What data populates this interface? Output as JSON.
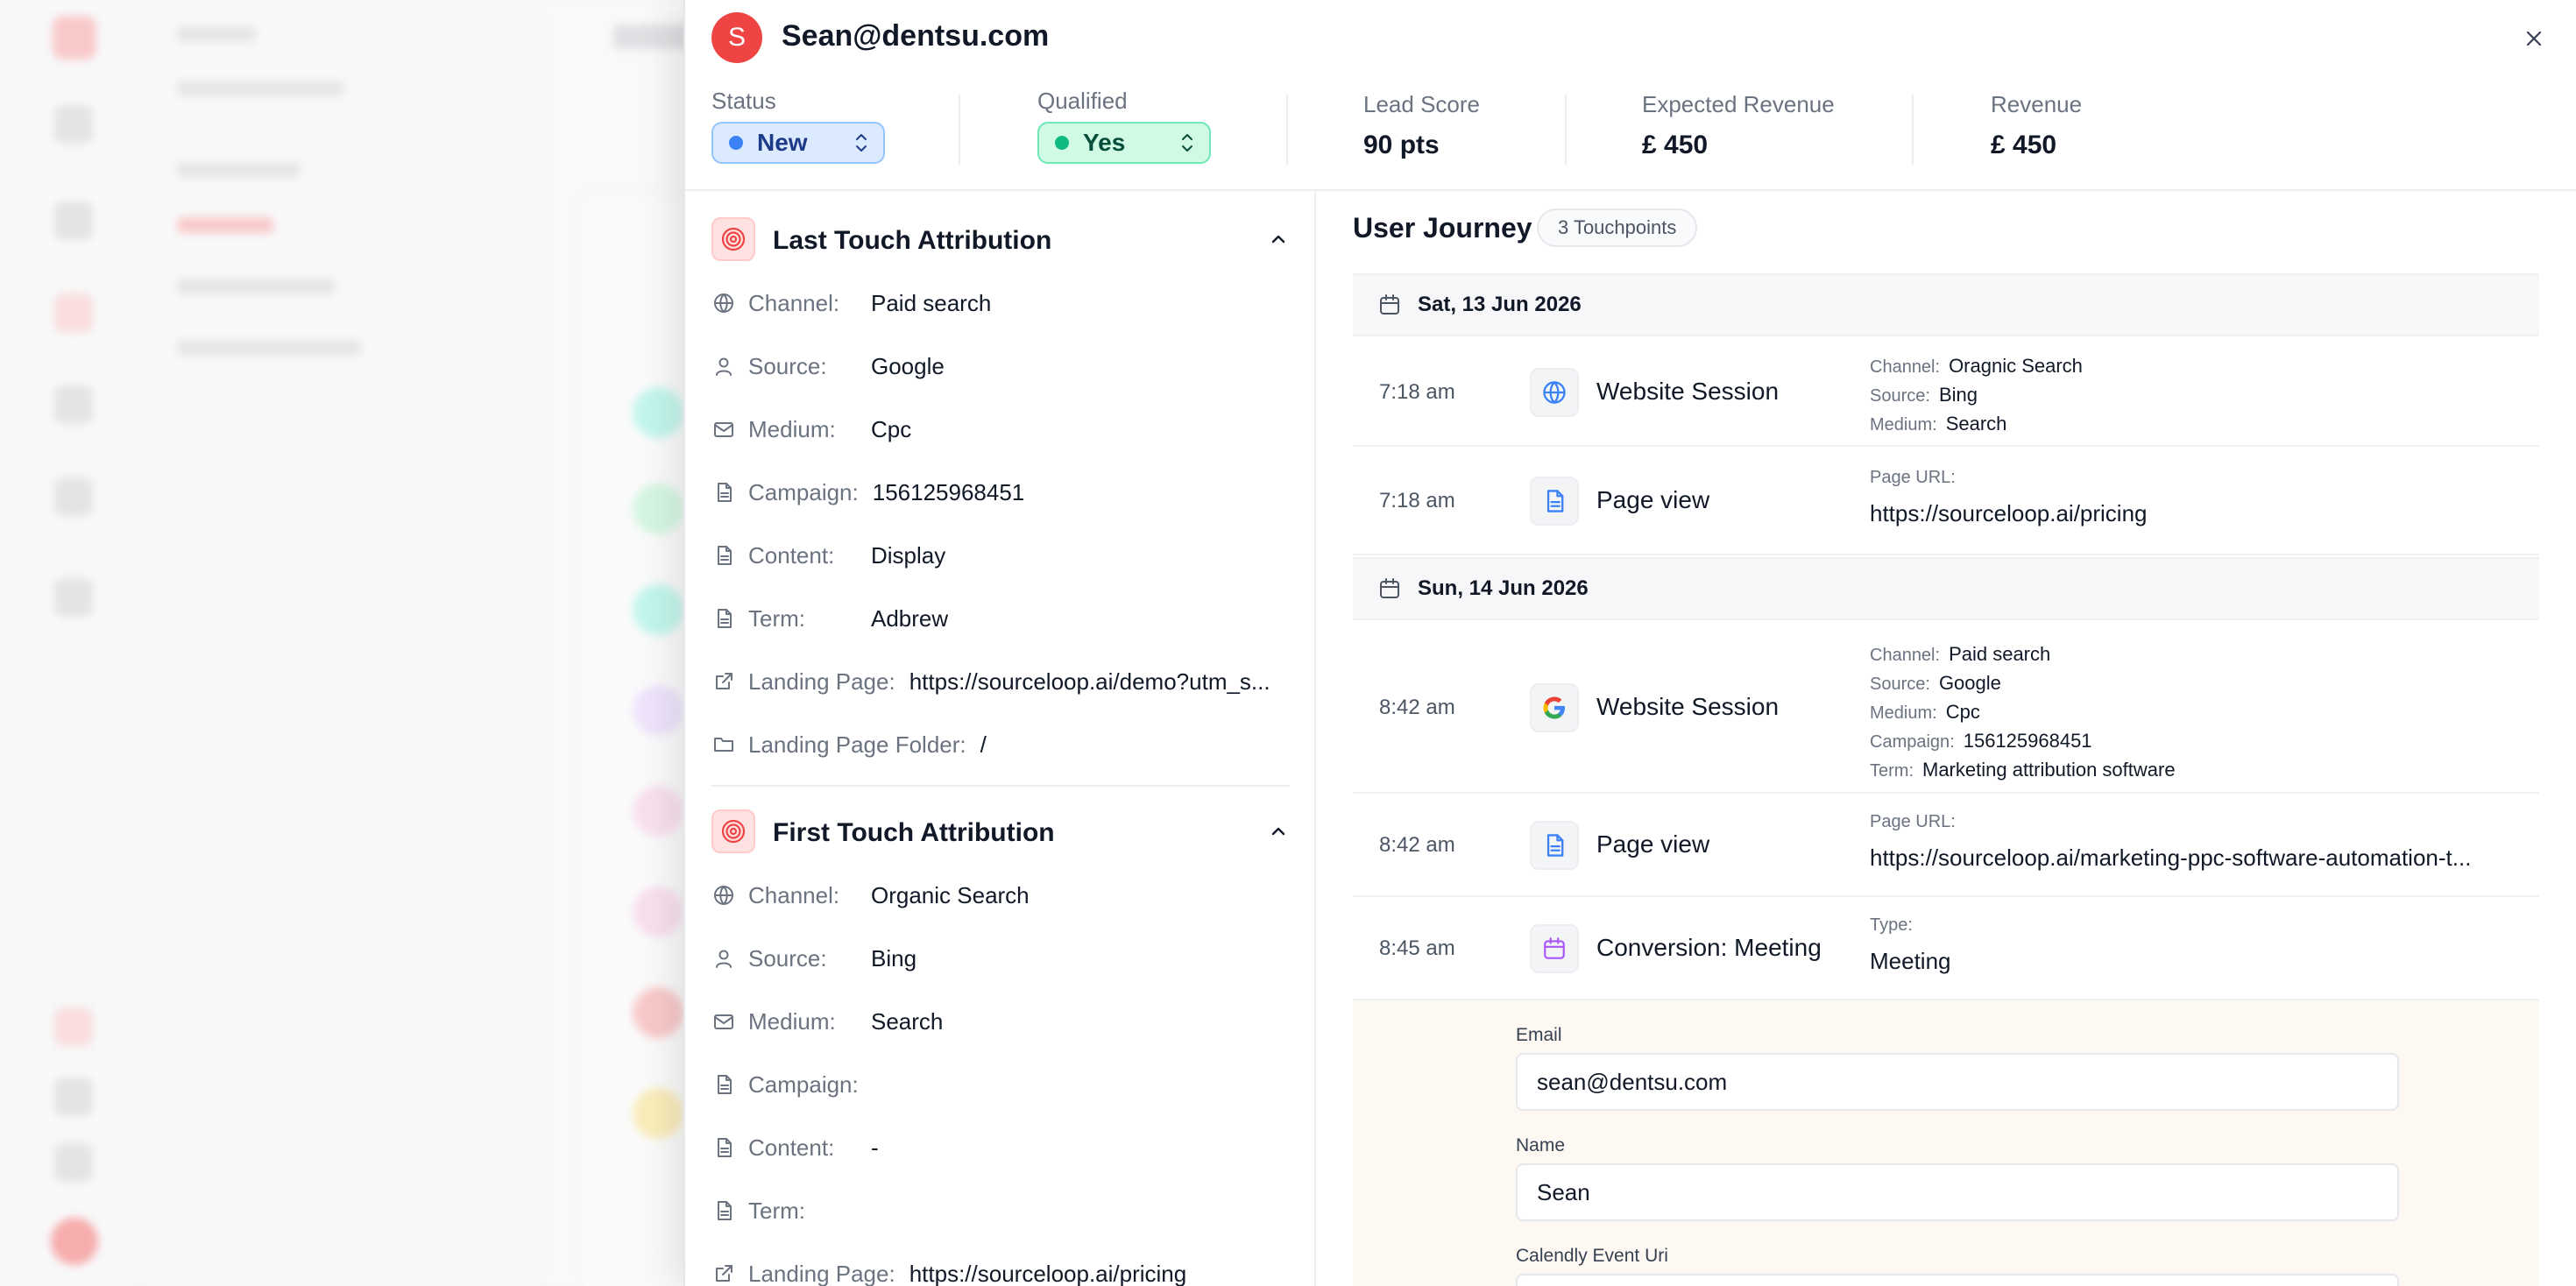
{
  "panel": {
    "avatar_initial": "S",
    "title": "Sean@dentsu.com"
  },
  "stats": {
    "status_label": "Status",
    "status_value": "New",
    "qualified_label": "Qualified",
    "qualified_value": "Yes",
    "lead_score_label": "Lead Score",
    "lead_score_value": "90 pts",
    "expected_revenue_label": "Expected Revenue",
    "expected_revenue_value": "£ 450",
    "revenue_label": "Revenue",
    "revenue_value": "£ 450"
  },
  "last_touch": {
    "title": "Last Touch Attribution",
    "rows": [
      {
        "key": "Channel:",
        "value": "Paid search",
        "icon": "globe-icon"
      },
      {
        "key": "Source:",
        "value": "Google",
        "icon": "user-icon"
      },
      {
        "key": "Medium:",
        "value": "Cpc",
        "icon": "mail-icon"
      },
      {
        "key": "Campaign:",
        "value": "156125968451",
        "icon": "file-icon"
      },
      {
        "key": "Content:",
        "value": "Display",
        "icon": "file-icon"
      },
      {
        "key": "Term:",
        "value": "Adbrew",
        "icon": "file-icon"
      },
      {
        "key": "Landing Page:",
        "value": "https://sourceloop.ai/demo?utm_s...",
        "icon": "external-link-icon"
      },
      {
        "key": "Landing Page Folder:",
        "value": "/",
        "icon": "folder-icon"
      }
    ]
  },
  "first_touch": {
    "title": "First Touch Attribution",
    "rows": [
      {
        "key": "Channel:",
        "value": "Organic Search",
        "icon": "globe-icon"
      },
      {
        "key": "Source:",
        "value": "Bing",
        "icon": "user-icon"
      },
      {
        "key": "Medium:",
        "value": "Search",
        "icon": "mail-icon"
      },
      {
        "key": "Campaign:",
        "value": "",
        "icon": "file-icon"
      },
      {
        "key": "Content:",
        "value": "-",
        "icon": "file-icon"
      },
      {
        "key": "Term:",
        "value": "",
        "icon": "file-icon"
      },
      {
        "key": "Landing Page:",
        "value": "https://sourceloop.ai/pricing",
        "icon": "external-link-icon"
      }
    ]
  },
  "journey": {
    "title": "User Journey",
    "touchpoints": "3 Touchpoints",
    "dates": [
      "Sat, 13 Jun 2026",
      "Sun, 14 Jun 2026"
    ],
    "events": [
      {
        "time": "7:18 am",
        "name": "Website Session",
        "icon": "globe-icon",
        "details": [
          {
            "k": "Channel:",
            "v": "Oragnic Search"
          },
          {
            "k": "Source:",
            "v": "Bing"
          },
          {
            "k": "Medium:",
            "v": "Search"
          }
        ]
      },
      {
        "time": "7:18 am",
        "name": "Page view",
        "icon": "file-icon",
        "key": "Page URL:",
        "value": "https://sourceloop.ai/pricing"
      },
      {
        "time": "8:42 am",
        "name": "Website Session",
        "icon": "google-icon",
        "details": [
          {
            "k": "Channel:",
            "v": "Paid search"
          },
          {
            "k": "Source:",
            "v": "Google"
          },
          {
            "k": "Medium:",
            "v": "Cpc"
          },
          {
            "k": "Campaign:",
            "v": "156125968451"
          },
          {
            "k": "Term:",
            "v": "Marketing attribution software"
          }
        ]
      },
      {
        "time": "8:42 am",
        "name": "Page view",
        "icon": "file-icon",
        "key": "Page URL:",
        "value": "https://sourceloop.ai/marketing-ppc-software-automation-t..."
      },
      {
        "time": "8:45 am",
        "name": "Conversion: Meeting",
        "icon": "calendar-icon",
        "key": "Type:",
        "value": "Meeting"
      }
    ]
  },
  "form": {
    "email_label": "Email",
    "email_value": "sean@dentsu.com",
    "name_label": "Name",
    "name_value": "Sean",
    "calendly_label": "Calendly Event Uri"
  },
  "colors": {
    "accent": "#ef4444",
    "status_blue": "#3b82f6",
    "qualified_green": "#10b981",
    "conversion_purple": "#a855f7"
  }
}
